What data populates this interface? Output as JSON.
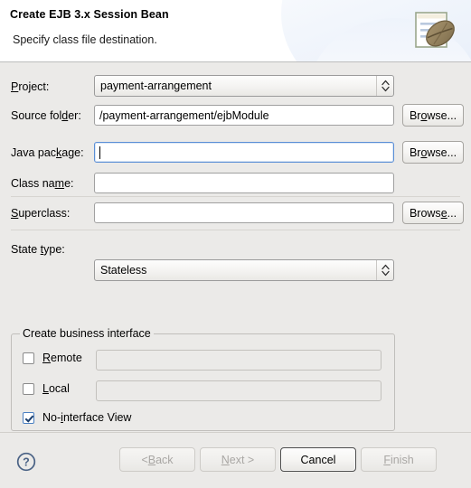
{
  "header": {
    "title": "Create EJB 3.x Session Bean",
    "subtitle": "Specify class file destination.",
    "icon": "ejb-bean-document-icon"
  },
  "form": {
    "project": {
      "label_pre": "P",
      "label_mn": "",
      "label_post": "roject:",
      "label": "Project:",
      "value": "payment-arrangement",
      "control": "combobox"
    },
    "source_folder": {
      "label": "Source folder:",
      "value": "/payment-arrangement/ejbModule",
      "browse_label": "Browse..."
    },
    "java_package": {
      "label": "Java package:",
      "value": "",
      "browse_label": "Browse...",
      "focused": true
    },
    "class_name": {
      "label": "Class name:",
      "value": ""
    },
    "superclass": {
      "label": "Superclass:",
      "value": "",
      "browse_label": "Browse..."
    },
    "state_type": {
      "label": "State type:",
      "value": "Stateless",
      "control": "combobox"
    }
  },
  "business_interface": {
    "group_title": "Create business interface",
    "remote": {
      "label": "Remote",
      "checked": false,
      "value": "",
      "enabled": false
    },
    "local": {
      "label": "Local",
      "checked": false,
      "value": "",
      "enabled": false
    },
    "no_interface_view": {
      "label": "No-interface View",
      "checked": true
    }
  },
  "footer": {
    "help_icon": "help-question-icon",
    "buttons": [
      {
        "label": "< Back",
        "enabled": false,
        "default": false
      },
      {
        "label": "Next >",
        "enabled": false,
        "default": false
      },
      {
        "label": "Cancel",
        "enabled": true,
        "default": true
      },
      {
        "label": "Finish",
        "enabled": false,
        "default": false
      }
    ]
  },
  "colors": {
    "dialog_bg": "#ebeae8",
    "header_bg": "#ffffff",
    "focus_border": "#5b8fd6",
    "help_icon": "#4a6285"
  }
}
